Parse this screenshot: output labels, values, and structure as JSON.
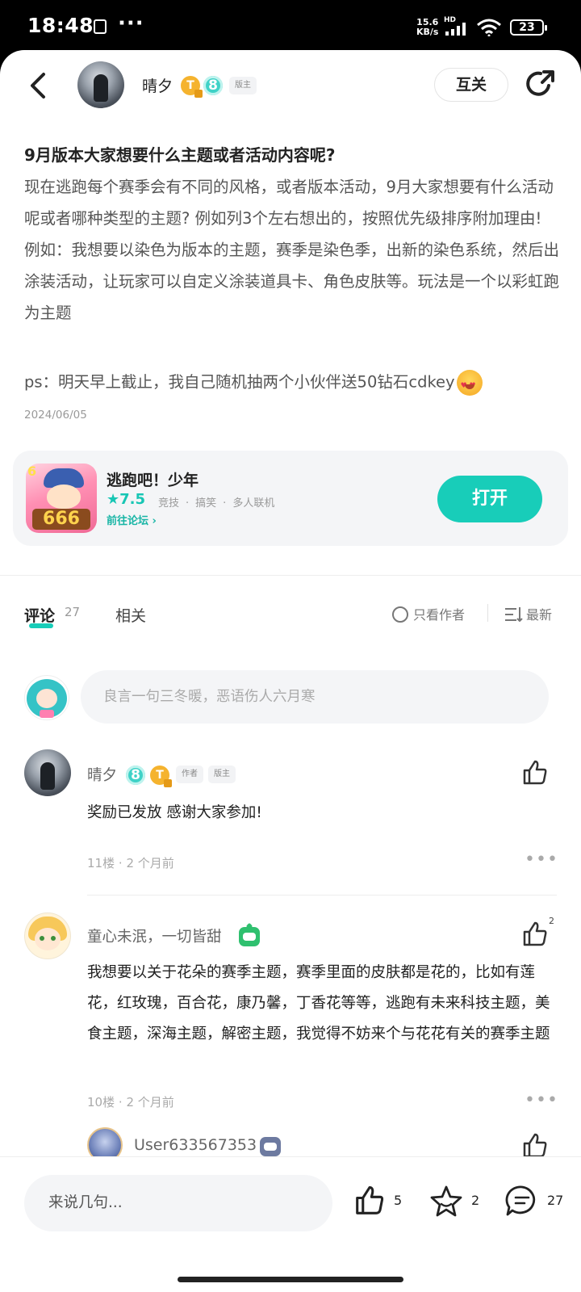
{
  "status_bar": {
    "time": "18:48",
    "dots": "···",
    "net_speed_value": "15.6",
    "net_speed_unit": "KB/s",
    "hd": "HD",
    "battery": "23"
  },
  "header": {
    "poster_name": "晴夕",
    "badge_t": "T",
    "badge_level": "8",
    "role_tag": "版主",
    "follow_label": "互关"
  },
  "post": {
    "title": "9月版本大家想要什么主题或者活动内容呢?",
    "para1": "现在逃跑每个赛季会有不同的风格，或者版本活动，9月大家想要有什么活动呢或者哪种类型的主题? 例如列3个左右想出的，按照优先级排序附加理由!",
    "para2": "例如：我想要以染色为版本的主题，赛季是染色季，出新的染色系统，然后出涂装活动，让玩家可以自定义涂装道具卡、角色皮肤等。玩法是一个以彩虹跑为主题",
    "ps": "ps：明天早上截止，我自己随机抽两个小伙伴送50钻石cdkey",
    "date": "2024/06/05"
  },
  "game_card": {
    "name": "逃跑吧！少年",
    "rating": "7.5",
    "tags": [
      "竞技",
      "·",
      "搞笑",
      "·",
      "多人联机"
    ],
    "forum_link": "前往论坛",
    "open_label": "打开",
    "icon_badge": "6",
    "icon_number": "666"
  },
  "tabs": {
    "comments_label": "评论",
    "comments_count": "27",
    "related_label": "相关",
    "only_author_label": "只看作者",
    "sort_label": "最新"
  },
  "comment_input": {
    "placeholder": "良言一句三冬暖，恶语伤人六月寒"
  },
  "comments": [
    {
      "name": "晴夕",
      "tag_author": "作者",
      "tag_role": "版主",
      "text": "奖励已发放 感谢大家参加!",
      "floor": "11楼",
      "dot": "·",
      "time": "2 个月前",
      "likes": ""
    },
    {
      "name": "童心未泯，一切皆甜",
      "text": "我想要以关于花朵的赛季主题，赛季里面的皮肤都是花的，比如有莲花，红玫瑰，百合花，康乃馨，丁香花等等，逃跑有未来科技主题，美食主题，深海主题，解密主题，我觉得不妨来个与花花有关的赛季主题",
      "floor": "10楼",
      "dot": "·",
      "time": "2 个月前",
      "likes": "2"
    },
    {
      "name": "User633567353"
    }
  ],
  "bottom_bar": {
    "say_placeholder": "来说几句...",
    "like_count": "5",
    "fav_count": "2",
    "comment_count": "27"
  },
  "colors": {
    "accent": "#18cdb9",
    "badge_gold": "#f5b32e",
    "badge_teal": "#3fd2c7"
  }
}
